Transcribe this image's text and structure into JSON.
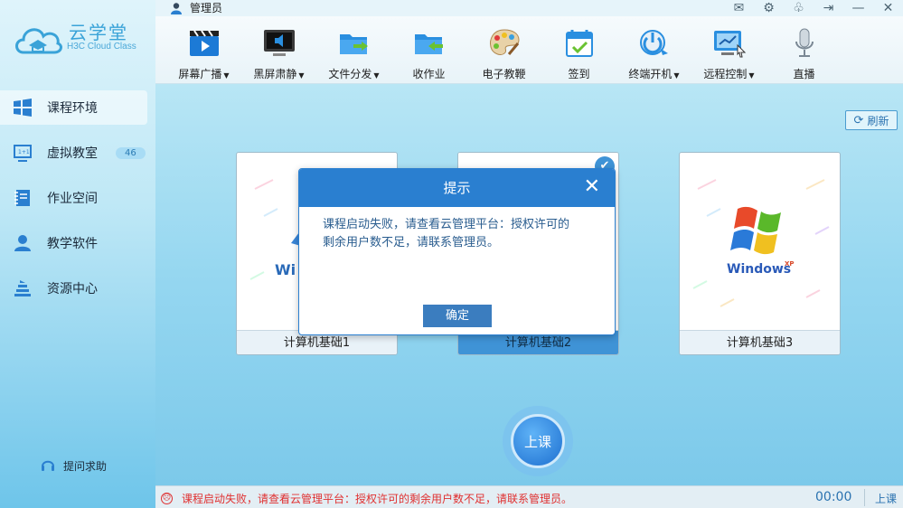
{
  "app": {
    "brand": "云学堂",
    "brand_sub": "H3C Cloud Class"
  },
  "titlebar": {
    "user": "管理员",
    "icons": [
      "mail-icon",
      "settings-icon",
      "skin-icon",
      "logout-icon",
      "minimize-icon",
      "close-icon"
    ]
  },
  "toolbar": [
    {
      "label": "屏幕广播",
      "dropdown": true,
      "icon": "video-clapper-icon"
    },
    {
      "label": "黑屏肃静",
      "dropdown": true,
      "icon": "monitor-mute-icon"
    },
    {
      "label": "文件分发",
      "dropdown": true,
      "icon": "folder-send-icon"
    },
    {
      "label": "收作业",
      "dropdown": false,
      "icon": "folder-receive-icon"
    },
    {
      "label": "电子教鞭",
      "dropdown": false,
      "icon": "palette-icon"
    },
    {
      "label": "签到",
      "dropdown": false,
      "icon": "calendar-check-icon"
    },
    {
      "label": "终端开机",
      "dropdown": true,
      "icon": "power-icon"
    },
    {
      "label": "远程控制",
      "dropdown": true,
      "icon": "remote-monitor-icon"
    },
    {
      "label": "直播",
      "dropdown": false,
      "icon": "microphone-icon"
    }
  ],
  "sidebar": {
    "items": [
      {
        "label": "课程环境",
        "active": true
      },
      {
        "label": "虚拟教室",
        "badge": "46"
      },
      {
        "label": "作业空间"
      },
      {
        "label": "教学软件"
      },
      {
        "label": "资源中心"
      }
    ],
    "help": "提问求助"
  },
  "main": {
    "refresh": "刷新",
    "cards": [
      {
        "name": "计算机基础1",
        "selected": false,
        "thumb_text": "Wi"
      },
      {
        "name": "计算机基础2",
        "selected": true
      },
      {
        "name": "计算机基础3",
        "selected": false,
        "thumb_text": "Windows",
        "thumb_sup": "XP"
      }
    ],
    "start_button": "上课"
  },
  "dialog": {
    "title": "提示",
    "message_line1": "课程启动失败，请查看云管理平台：授权许可的",
    "message_line2": "剩余用户数不足，请联系管理员。",
    "ok": "确定"
  },
  "status": {
    "message": "课程启动失败，请查看云管理平台：授权许可的剩余用户数不足，请联系管理员。",
    "timer": "00:00",
    "class_label": "上课"
  },
  "colors": {
    "accent": "#2a7fd0",
    "error": "#e03030",
    "selected": "#3f93d6"
  }
}
